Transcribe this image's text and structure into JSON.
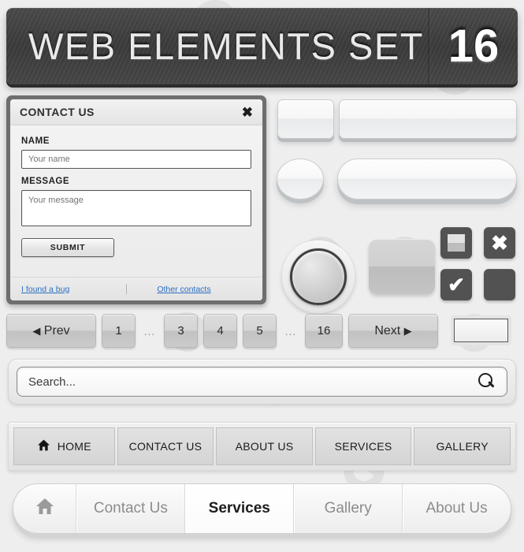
{
  "header": {
    "title": "WEB ELEMENTS SET",
    "number": "16"
  },
  "contact_form": {
    "title": "CONTACT US",
    "close_icon": "close-icon",
    "name_label": "NAME",
    "name_placeholder": "Your name",
    "name_value": "",
    "message_label": "MESSAGE",
    "message_placeholder": "Your message",
    "message_value": "",
    "submit_label": "SUBMIT",
    "footer_links": [
      {
        "label": "I found a bug"
      },
      {
        "label": "Other contacts"
      }
    ]
  },
  "buttons_panel": {
    "small_rect_label": "",
    "wide_rect_label": "",
    "round_label": "",
    "pill_label": "",
    "big_circle_label": "",
    "gray_square_label": "",
    "icon_buttons": [
      {
        "name": "stop-square-icon",
        "glyph": ""
      },
      {
        "name": "close-x-icon",
        "glyph": "✖"
      },
      {
        "name": "check-icon",
        "glyph": "✔"
      },
      {
        "name": "blank-icon",
        "glyph": ""
      }
    ]
  },
  "pagination": {
    "prev_label": "Prev",
    "prev_arrow": "◀",
    "next_label": "Next",
    "next_arrow": "▶",
    "ellipsis": "...",
    "pages": [
      "1",
      "3",
      "4",
      "5",
      "16"
    ],
    "goto_value": "",
    "goto_placeholder": ""
  },
  "search": {
    "placeholder": "Search...",
    "value": "Search...",
    "icon": "search-icon"
  },
  "nav_square": {
    "home_icon": "home-icon",
    "items": [
      {
        "label": "HOME",
        "icon": "home-icon"
      },
      {
        "label": "CONTACT US"
      },
      {
        "label": "ABOUT US"
      },
      {
        "label": "SERVICES"
      },
      {
        "label": "GALLERY"
      }
    ]
  },
  "nav_rounded": {
    "home_icon": "home-icon",
    "items": [
      {
        "label": "",
        "icon": "home-icon",
        "active": false
      },
      {
        "label": "Contact Us",
        "active": false
      },
      {
        "label": "Services",
        "active": true
      },
      {
        "label": "Gallery",
        "active": false
      },
      {
        "label": "About Us",
        "active": false
      }
    ]
  },
  "colors": {
    "page_background": "#eeeeee",
    "header_dark": "#434343",
    "link_blue": "#2c6fc4",
    "icon_square_dark": "#525252",
    "pager_gray": "#d0d0d0"
  }
}
